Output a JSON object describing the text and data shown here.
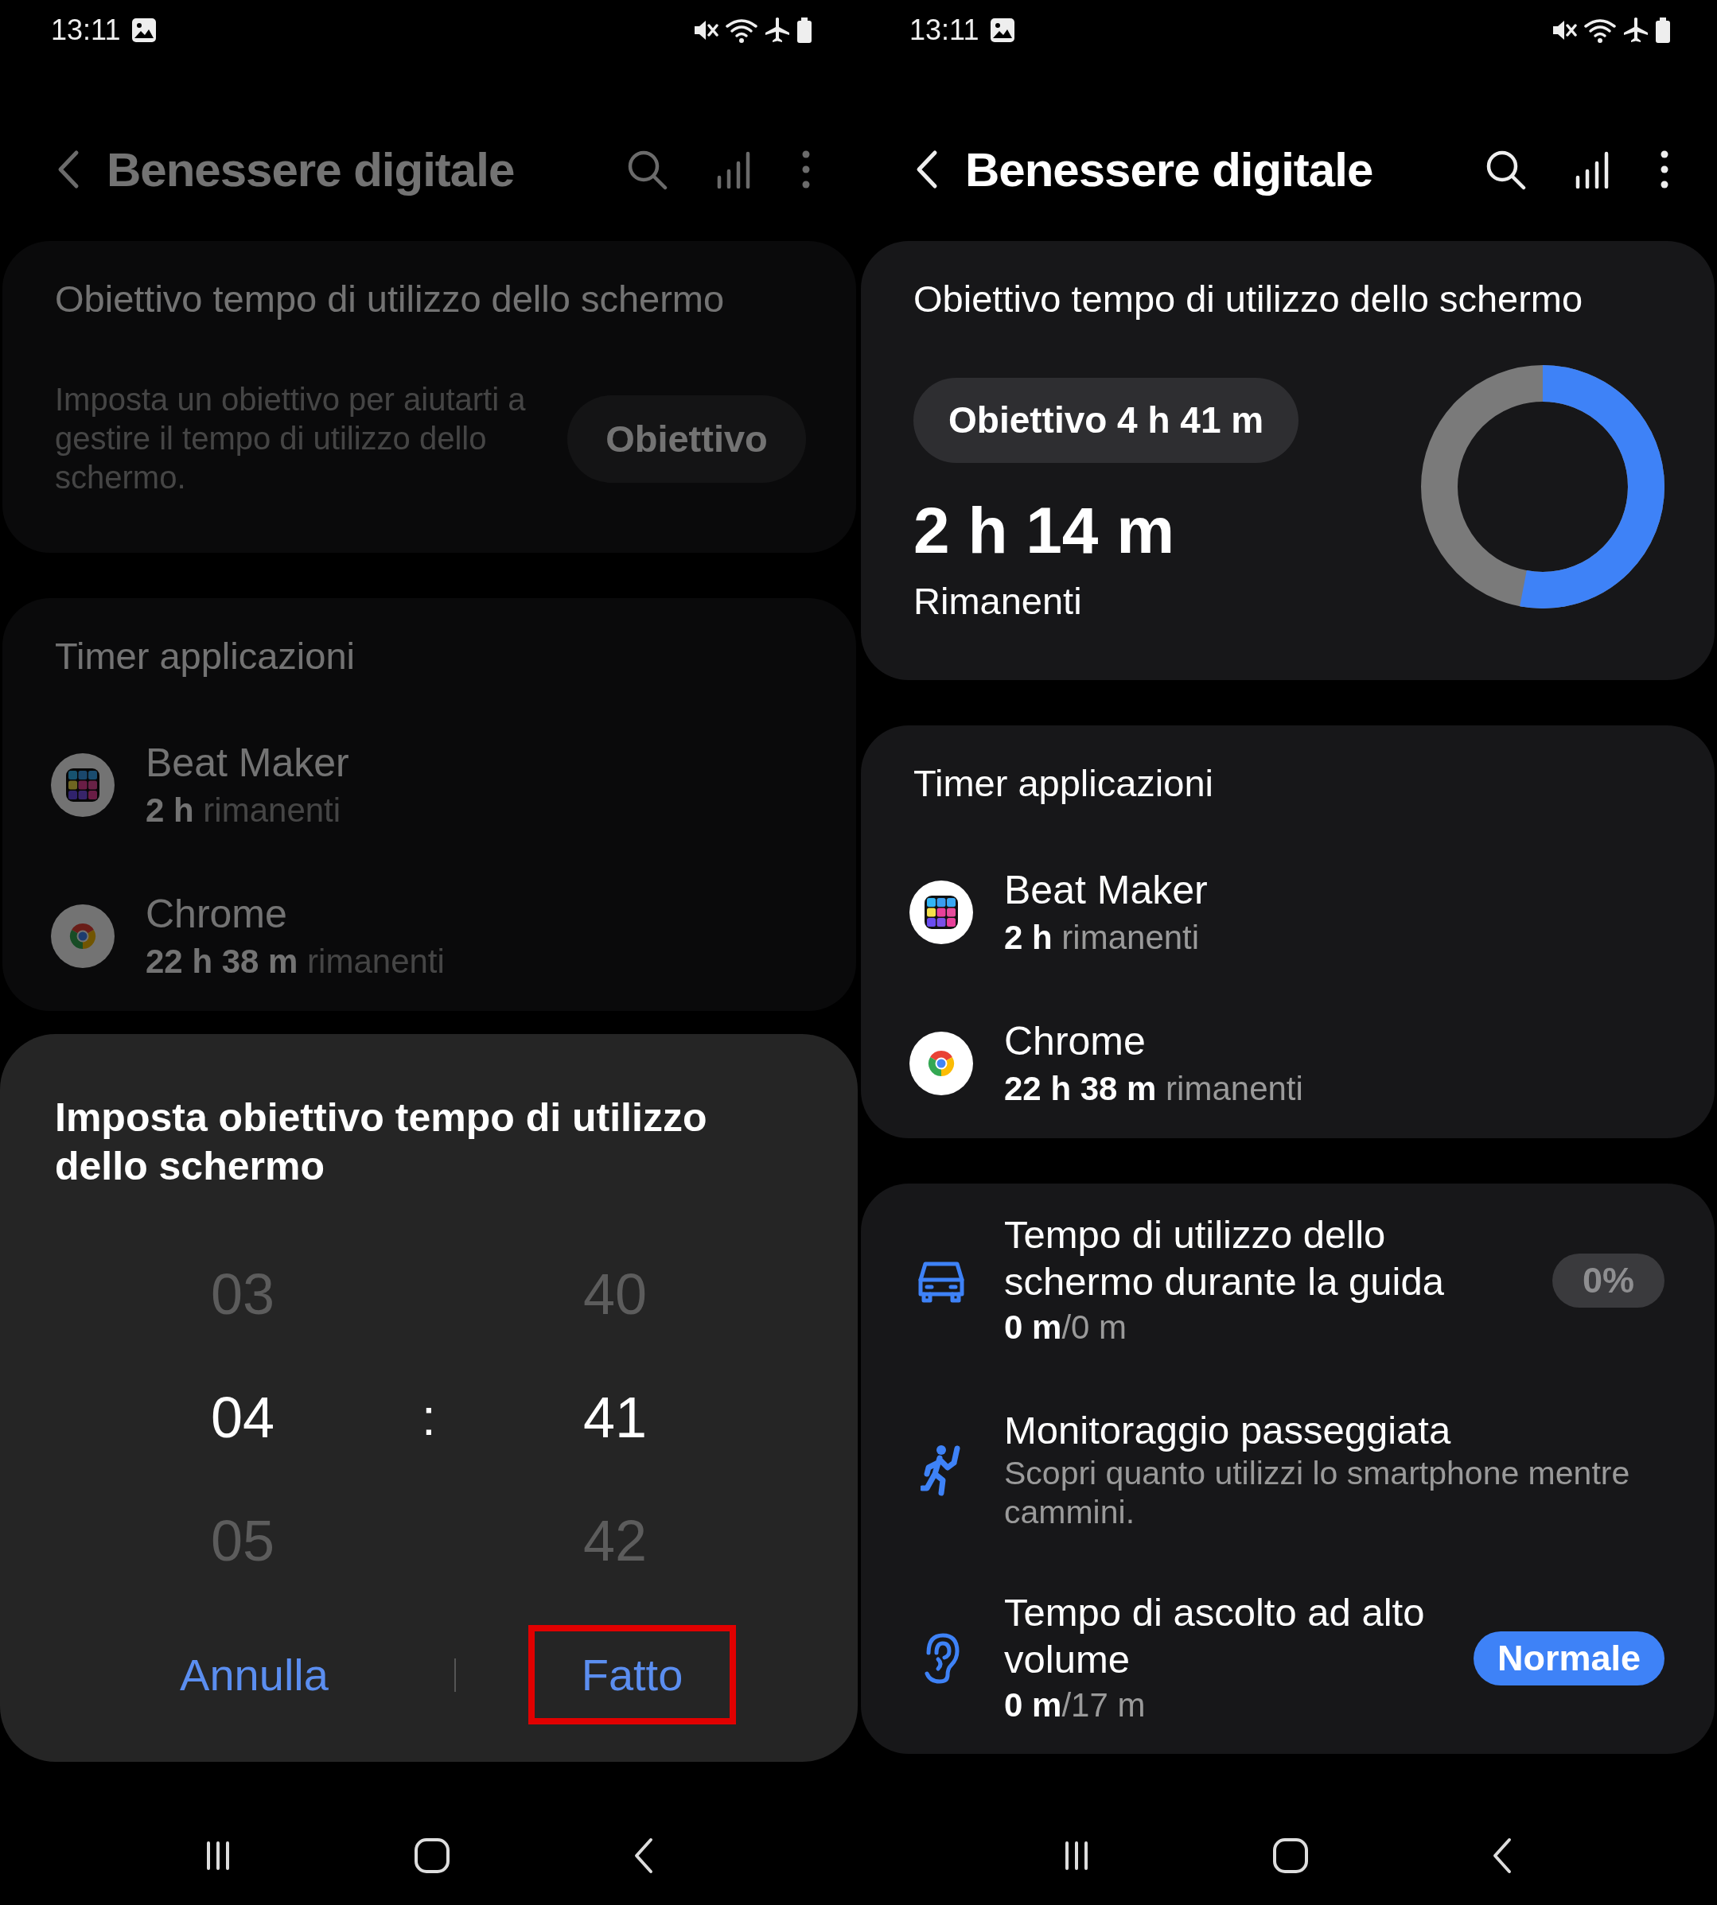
{
  "screens": [
    {
      "dimmed": true,
      "status_bar": {
        "time": "13:11"
      },
      "header": {
        "title": "Benessere digitale"
      },
      "goal_card": {
        "kind": "unset",
        "title": "Obiettivo tempo di utilizzo dello schermo",
        "description": "Imposta un obiettivo per aiutarti a gestire il tempo di utilizzo dello schermo.",
        "button": "Obiettivo"
      },
      "timer_card": {
        "title": "Timer applicazioni",
        "apps": [
          {
            "kind": "grid",
            "name": "Beat Maker",
            "remaining": "**2 h** rimanenti"
          },
          {
            "kind": "chrome",
            "name": "Chrome",
            "remaining": "**22 h 38 m** rimanenti"
          }
        ]
      },
      "dialog": {
        "title": "Imposta obiettivo tempo di utilizzo dello schermo",
        "hours": [
          {
            "value": "03",
            "selected": false
          },
          {
            "value": "04",
            "selected": true
          },
          {
            "value": "05",
            "selected": false
          }
        ],
        "separator": ":",
        "minutes": [
          {
            "value": "40",
            "selected": false
          },
          {
            "value": "41",
            "selected": true
          },
          {
            "value": "42",
            "selected": false
          }
        ],
        "buttons": [
          {
            "label": "Annulla",
            "highlighted": false
          },
          {
            "label": "Fatto",
            "highlighted": true
          }
        ]
      }
    },
    {
      "dimmed": false,
      "status_bar": {
        "time": "13:11"
      },
      "header": {
        "title": "Benessere digitale"
      },
      "goal_card": {
        "kind": "set",
        "title": "Obiettivo tempo di utilizzo dello schermo",
        "goal": "Obiettivo 4 h 41 m",
        "remaining_time": "2 h 14 m",
        "remaining_label": "Rimanenti",
        "ring": {
          "level": 0.53
        }
      },
      "timer_card": {
        "title": "Timer applicazioni",
        "apps": [
          {
            "kind": "grid",
            "name": "Beat Maker",
            "remaining": "**2 h** rimanenti"
          },
          {
            "kind": "chrome",
            "name": "Chrome",
            "remaining": "**22 h 38 m** rimanenti"
          }
        ]
      },
      "feature_card": {
        "items": [
          {
            "kind": "driving",
            "title": "Tempo di utilizzo dello schermo durante la guida",
            "detail": "**0 m**/0 m",
            "badge": {
              "text": "0%",
              "active": false
            }
          },
          {
            "kind": "walking",
            "title": "Monitoraggio passeggiata",
            "detail": "Scopri quanto utilizzi lo smartphone mentre cammini."
          },
          {
            "kind": "listening",
            "title": "Tempo di ascolto ad alto volume",
            "detail": "**0 m**/17 m",
            "badge": {
              "text": "Normale",
              "active": true
            }
          }
        ]
      }
    }
  ]
}
